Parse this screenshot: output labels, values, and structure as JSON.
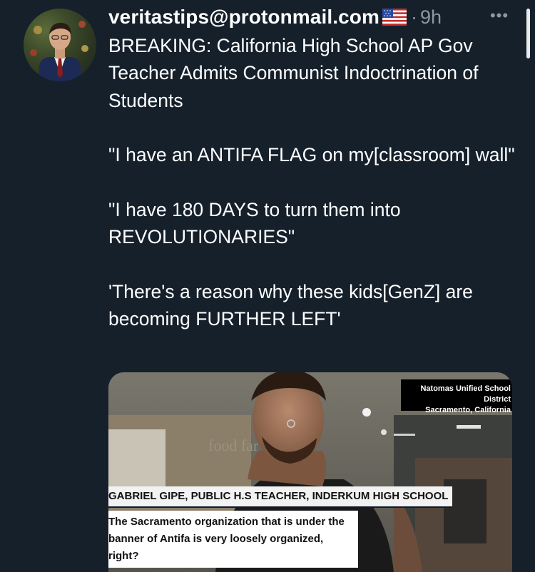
{
  "tweet": {
    "username": "veritastips@protonmail.com",
    "flag_icon": "us-flag-emoji",
    "separator": "·",
    "time": "9h",
    "more_icon": "more-horizontal-icon",
    "more_label": "•••",
    "text": "BREAKING: California High School AP Gov Teacher Admits Communist Indoctrination of Students\n\n\"I have an ANTIFA FLAG on my[classroom] wall\"\n\n\"I have 180 DAYS to turn them into REVOLUTIONARIES\"\n\n'There's a reason why these kids[GenZ] are becoming FURTHER LEFT'"
  },
  "media": {
    "location_line1": "Natomas Unified School District",
    "location_line2": "Sacramento, California",
    "name_lower_third": "GABRIEL GIPE, PUBLIC H.S TEACHER, INDERKUM HIGH SCHOOL",
    "caption": "The Sacramento organization that is under the banner of Antifa is very loosely organized, right?",
    "background_sign": "food far"
  },
  "colors": {
    "background": "#15202b",
    "secondary_text": "#8899a6",
    "primary_text": "#ffffff"
  }
}
